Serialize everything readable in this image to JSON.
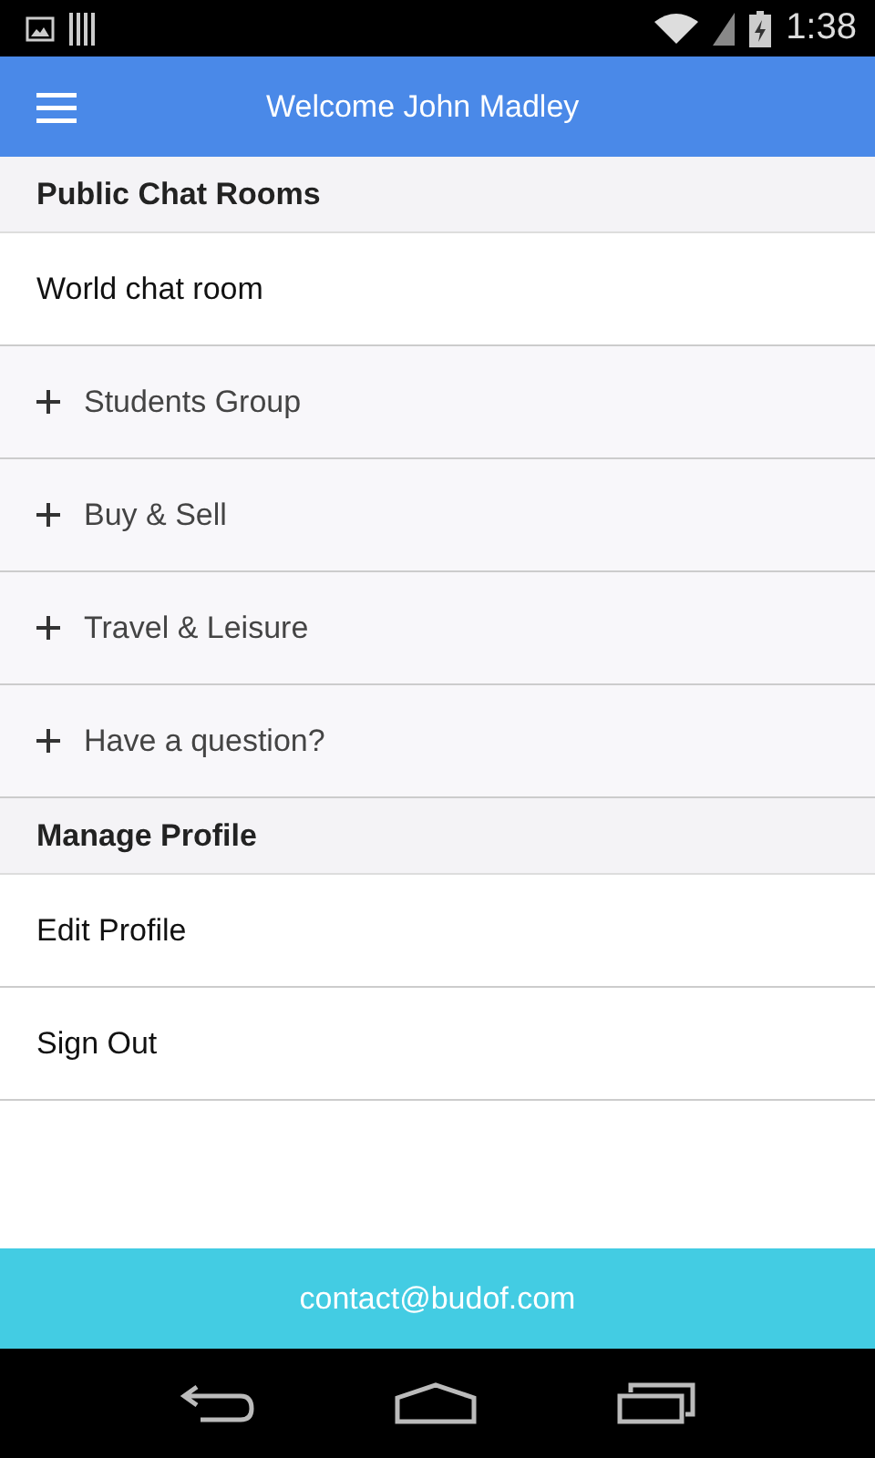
{
  "status_bar": {
    "time": "1:38"
  },
  "app_bar": {
    "title": "Welcome John Madley"
  },
  "sections": [
    {
      "title": "Public Chat Rooms",
      "items": [
        {
          "label": "World chat room",
          "kind": "plain"
        },
        {
          "label": "Students Group",
          "kind": "expandable"
        },
        {
          "label": "Buy & Sell",
          "kind": "expandable"
        },
        {
          "label": "Travel & Leisure",
          "kind": "expandable"
        },
        {
          "label": "Have a question?",
          "kind": "expandable"
        }
      ]
    },
    {
      "title": "Manage Profile",
      "items": [
        {
          "label": "Edit Profile",
          "kind": "plain"
        },
        {
          "label": "Sign Out",
          "kind": "plain"
        }
      ]
    }
  ],
  "footer": {
    "text": "contact@budof.com"
  }
}
